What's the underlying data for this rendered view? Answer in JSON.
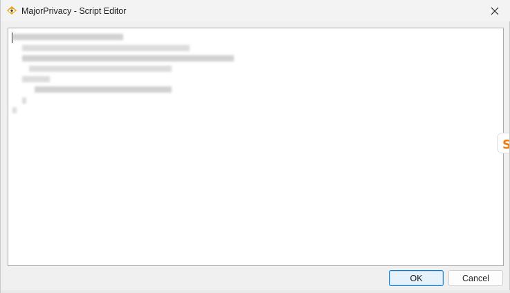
{
  "window": {
    "title": "MajorPrivacy - Script Editor"
  },
  "editor": {
    "content_note": ""
  },
  "buttons": {
    "ok_label": "OK",
    "cancel_label": "Cancel"
  },
  "icons": {
    "app": "eye-shield-icon",
    "close": "close-icon",
    "side_tab": "orange-s-badge-icon"
  },
  "colors": {
    "accent": "#0078d4",
    "app_icon_gold": "#e8a20c",
    "side_tab_orange": "#f07c12"
  }
}
